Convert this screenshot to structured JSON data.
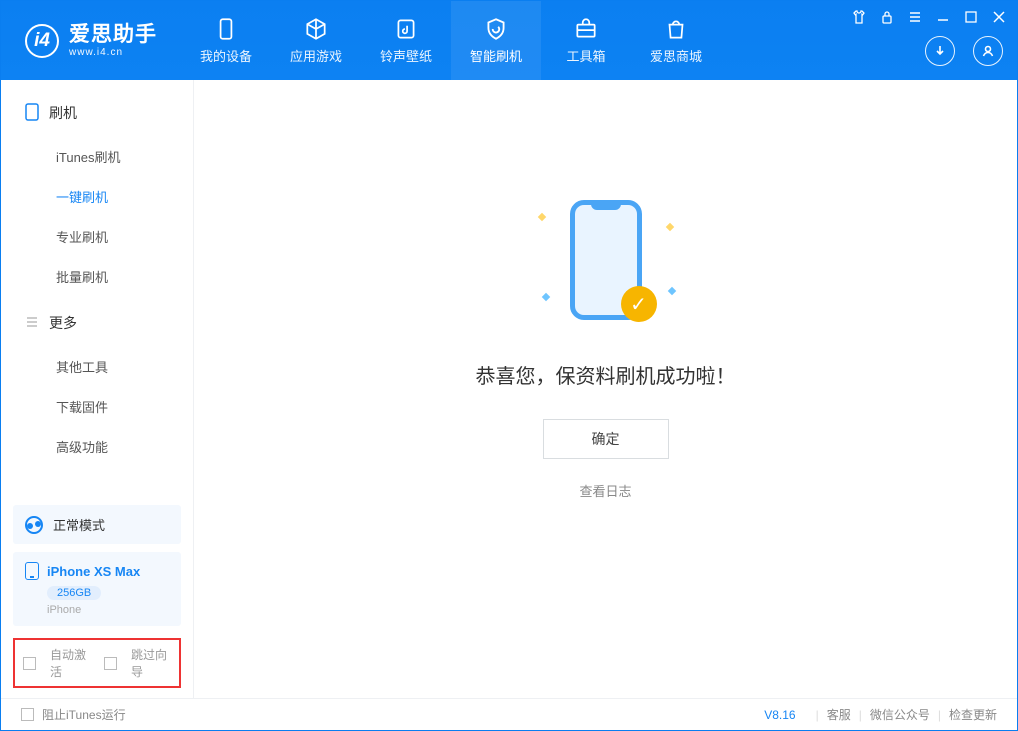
{
  "header": {
    "logo_title": "爱思助手",
    "logo_sub": "www.i4.cn",
    "tabs": [
      {
        "label": "我的设备"
      },
      {
        "label": "应用游戏"
      },
      {
        "label": "铃声壁纸"
      },
      {
        "label": "智能刷机"
      },
      {
        "label": "工具箱"
      },
      {
        "label": "爱思商城"
      }
    ]
  },
  "sidebar": {
    "section1_title": "刷机",
    "items1": [
      {
        "label": "iTunes刷机"
      },
      {
        "label": "一键刷机"
      },
      {
        "label": "专业刷机"
      },
      {
        "label": "批量刷机"
      }
    ],
    "section2_title": "更多",
    "items2": [
      {
        "label": "其他工具"
      },
      {
        "label": "下载固件"
      },
      {
        "label": "高级功能"
      }
    ],
    "mode_label": "正常模式",
    "device_name": "iPhone XS Max",
    "device_capacity": "256GB",
    "device_type": "iPhone",
    "chk_auto_activate": "自动激活",
    "chk_skip_wizard": "跳过向导"
  },
  "main": {
    "success_text": "恭喜您，保资料刷机成功啦！",
    "ok_button": "确定",
    "view_log": "查看日志"
  },
  "footer": {
    "block_itunes": "阻止iTunes运行",
    "version": "V8.16",
    "link_service": "客服",
    "link_wechat": "微信公众号",
    "link_update": "检查更新"
  }
}
